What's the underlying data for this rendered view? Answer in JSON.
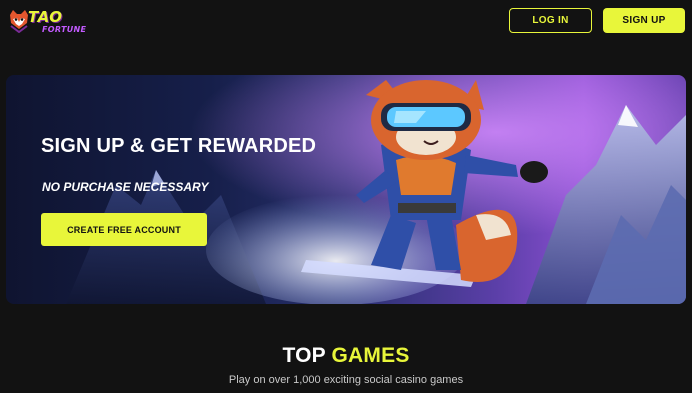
{
  "header": {
    "logo": {
      "line1": "TAO",
      "line2": "FORTUNE"
    },
    "login_label": "LOG IN",
    "signup_label": "SIGN UP"
  },
  "hero": {
    "title": "SIGN UP & GET REWARDED",
    "subtitle": "NO PURCHASE NECESSARY",
    "cta_label": "CREATE FREE ACCOUNT",
    "illustration": "red-panda-snowboarder"
  },
  "top_games": {
    "title_part1": "TOP",
    "title_part2": "GAMES",
    "subtitle": "Play on over 1,000 exciting social casino games"
  },
  "colors": {
    "background": "#121212",
    "accent": "#e8f63a",
    "logo_purple": "#c35bff"
  }
}
